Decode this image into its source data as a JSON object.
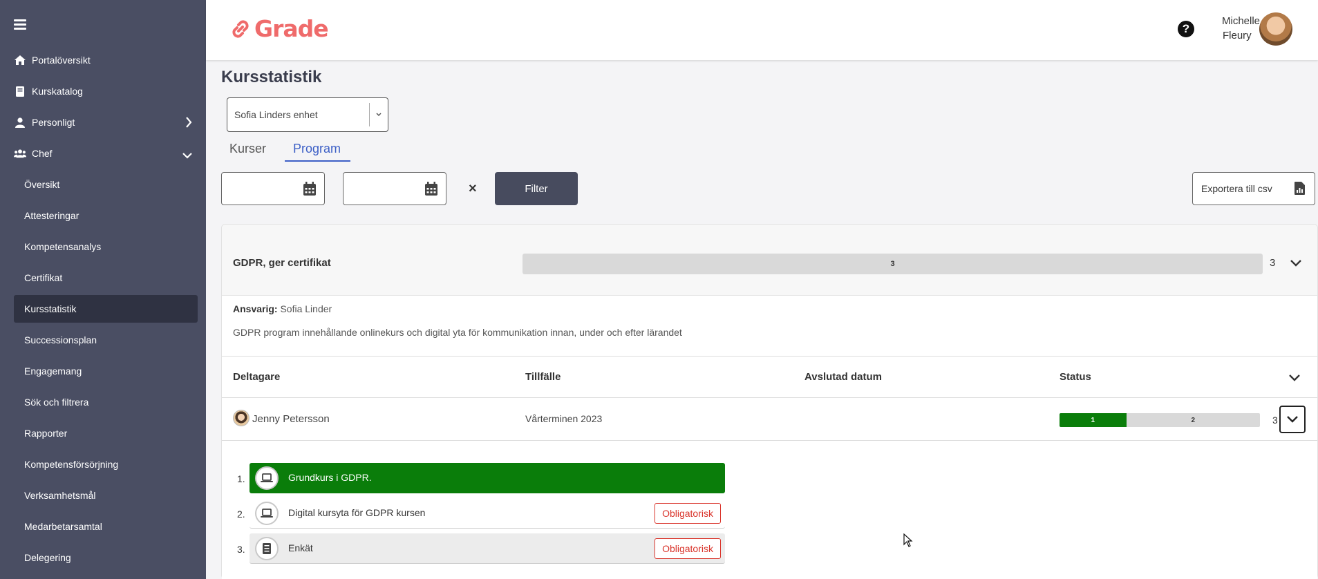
{
  "sidebar": {
    "items": [
      {
        "label": "Portalöversikt",
        "icon": "home-icon"
      },
      {
        "label": "Kurskatalog",
        "icon": "book-icon"
      },
      {
        "label": "Personligt",
        "icon": "user-icon"
      },
      {
        "label": "Chef",
        "icon": "users-icon"
      }
    ],
    "sub_items": [
      {
        "label": "Översikt"
      },
      {
        "label": "Attesteringar"
      },
      {
        "label": "Kompetensanalys"
      },
      {
        "label": "Certifikat"
      },
      {
        "label": "Kursstatistik",
        "active": true
      },
      {
        "label": "Successionsplan"
      },
      {
        "label": "Engagemang"
      },
      {
        "label": "Sök och filtrera"
      },
      {
        "label": "Rapporter"
      },
      {
        "label": "Kompetensförsörjning"
      },
      {
        "label": "Verksamhetsmål"
      },
      {
        "label": "Medarbetarsamtal"
      },
      {
        "label": "Delegering"
      }
    ]
  },
  "header": {
    "logo_text": "Grade",
    "help": "?",
    "user_first": "Michelle",
    "user_last": "Fleury"
  },
  "main": {
    "title": "Kursstatistik",
    "unit_select": "Sofia Linders enhet",
    "tabs": [
      {
        "label": "Kurser",
        "active": false
      },
      {
        "label": "Program",
        "active": true
      }
    ],
    "clear": "×",
    "filter_label": "Filter",
    "export_label": "Exportera till csv"
  },
  "program": {
    "name": "GDPR, ger certifikat",
    "bar_value": "3",
    "count": "3",
    "responsible_label": "Ansvarig:",
    "responsible": "Sofia Linder",
    "description": "GDPR program innehållande onlinekurs och digital yta för kommunikation innan, under och efter lärandet",
    "columns": [
      "Deltagare",
      "Tillfälle",
      "Avslutad datum",
      "Status"
    ],
    "participant": {
      "name": "Jenny Petersson",
      "term": "Vårterminen 2023",
      "done": "1",
      "remaining": "2",
      "total": "3",
      "done_fraction": 0.333
    },
    "courses": [
      {
        "num": "1.",
        "title": "Grundkurs i GDPR.",
        "icon": "laptop-icon",
        "badge": ""
      },
      {
        "num": "2.",
        "title": "Digital kursyta för GDPR kursen",
        "icon": "laptop-icon",
        "badge": "Obligatorisk"
      },
      {
        "num": "3.",
        "title": "Enkät",
        "icon": "survey-icon",
        "badge": "Obligatorisk"
      }
    ]
  },
  "colors": {
    "sidebar": "#4a4e63",
    "sidebar_active": "#2f3242",
    "brand": "#ef6b6b",
    "progress_done": "#0a7d0a",
    "tab_active": "#3c5fc6",
    "badge": "#d9342b"
  }
}
